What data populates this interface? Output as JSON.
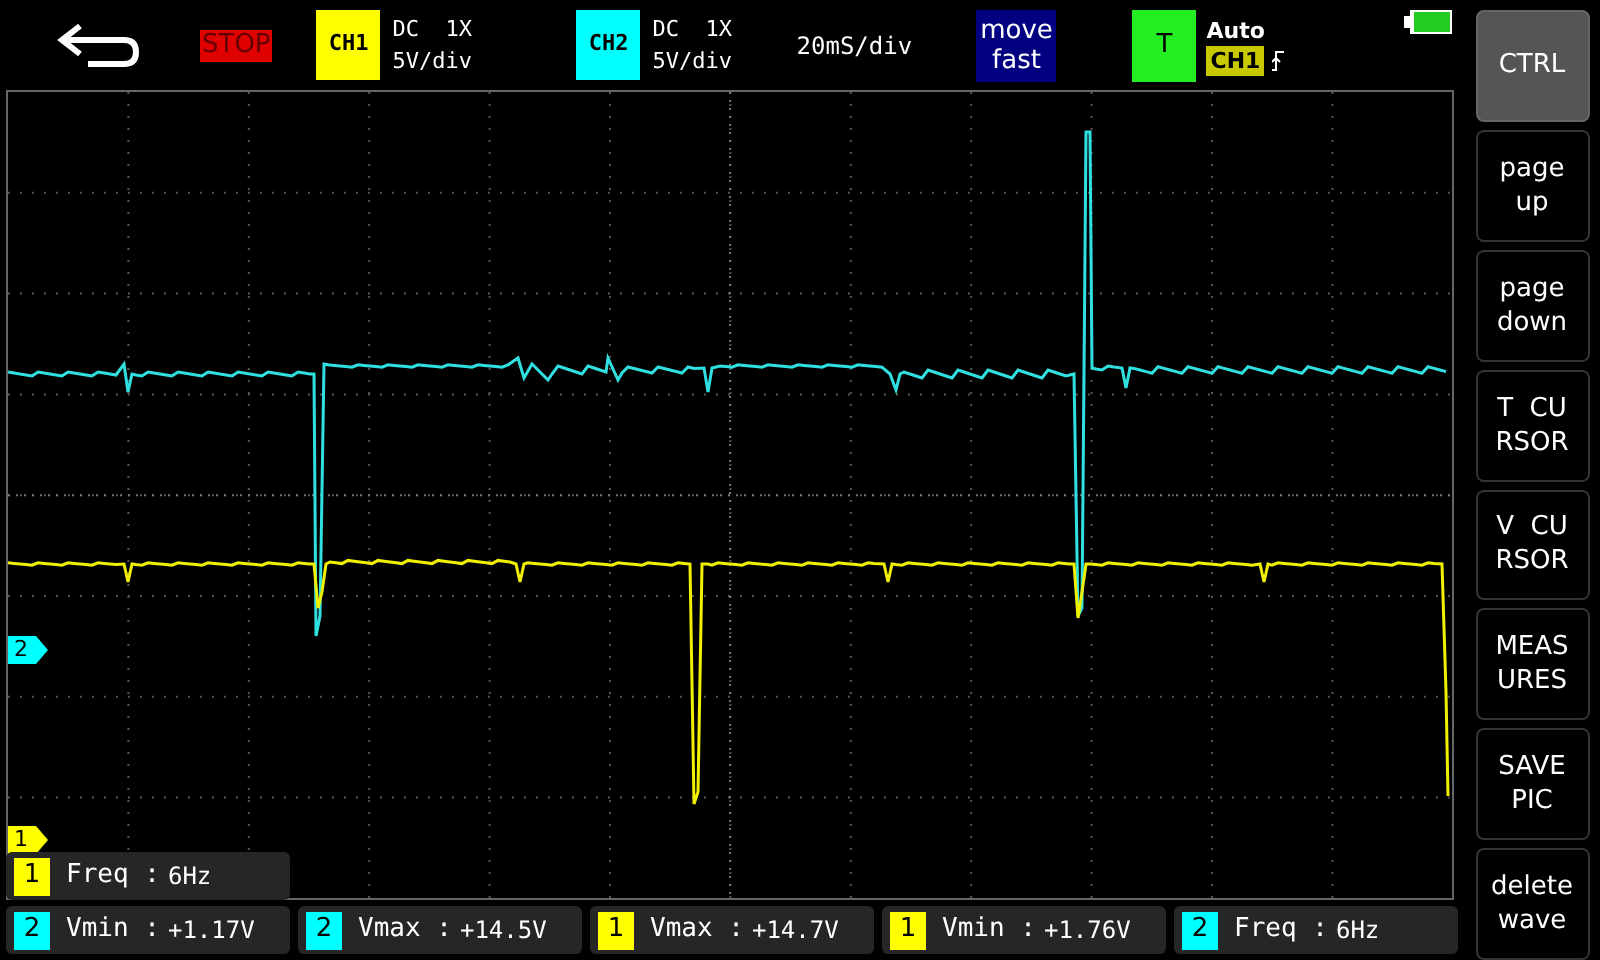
{
  "top_bar": {
    "run_state": "STOP",
    "channels": [
      {
        "label": "CH1",
        "color": "#ffff00",
        "coupling": "DC  1X",
        "scale": "5V/div"
      },
      {
        "label": "CH2",
        "color": "#00ffff",
        "coupling": "DC  1X",
        "scale": "5V/div"
      }
    ],
    "timebase": "20mS/div",
    "move_mode": [
      "move",
      "fast"
    ],
    "trigger": {
      "label": "T",
      "mode": "Auto",
      "source": "CH1"
    }
  },
  "side_buttons": [
    {
      "lines": [
        "CTRL"
      ],
      "selected": true
    },
    {
      "lines": [
        "page",
        "up"
      ],
      "selected": false
    },
    {
      "lines": [
        "page",
        "down"
      ],
      "selected": false
    },
    {
      "lines": [
        "T  CU",
        "RSOR"
      ],
      "selected": false
    },
    {
      "lines": [
        "V  CU",
        "RSOR"
      ],
      "selected": false
    },
    {
      "lines": [
        "MEAS",
        "URES"
      ],
      "selected": false
    },
    {
      "lines": [
        "SAVE",
        "PIC"
      ],
      "selected": false
    },
    {
      "lines": [
        "delete",
        "wave"
      ],
      "selected": false
    }
  ],
  "channel_markers": [
    {
      "label": "2",
      "color": "#00ffff"
    },
    {
      "label": "1",
      "color": "#ffff00"
    }
  ],
  "overlay_measurement": {
    "channel": "1",
    "color": "#ffff00",
    "label": "Freq :",
    "value": "6Hz"
  },
  "measurements": [
    {
      "channel": "2",
      "color": "#00ffff",
      "label": "Vmin :",
      "value": "+1.17V"
    },
    {
      "channel": "2",
      "color": "#00ffff",
      "label": "Vmax :",
      "value": "+14.5V"
    },
    {
      "channel": "1",
      "color": "#ffff00",
      "label": "Vmax :",
      "value": "+14.7V"
    },
    {
      "channel": "1",
      "color": "#ffff00",
      "label": "Vmin :",
      "value": "+1.76V"
    },
    {
      "channel": "2",
      "color": "#00ffff",
      "label": "Freq :",
      "value": "6Hz"
    }
  ]
}
